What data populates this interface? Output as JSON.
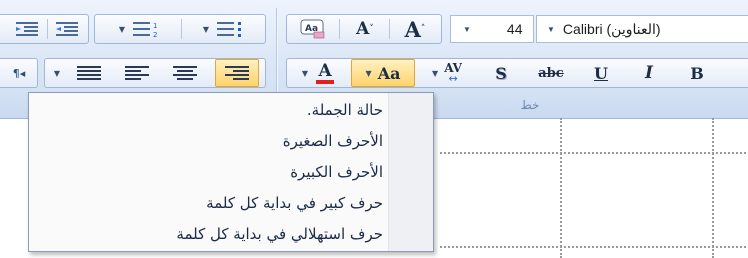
{
  "font_group": {
    "font_name": "Calibri (العناوين)",
    "font_size": "44",
    "grow_font_label": "A",
    "shrink_font_label": "A",
    "bold_label": "B",
    "italic_label": "I",
    "underline_label": "U",
    "strikethrough_label": "abc",
    "shadow_label": "S",
    "char_spacing_label": "AV",
    "change_case_label": "Aa",
    "font_color_label": "A",
    "group_label": "خط"
  },
  "paragraph_group": {
    "rtl_label": "¶◂"
  },
  "change_case_menu": {
    "items": [
      "حالة الجملة.",
      "الأحرف الصغيرة",
      "الأحرف الكبيرة",
      "حرف كبير في بداية كل كلمة",
      "حرف استهلالي في بداية كل كلمة"
    ]
  },
  "colors": {
    "accent_highlight": "#ffd36a",
    "font_color_bar": "#e02020",
    "ribbon_bg": "#d3e1f3"
  }
}
